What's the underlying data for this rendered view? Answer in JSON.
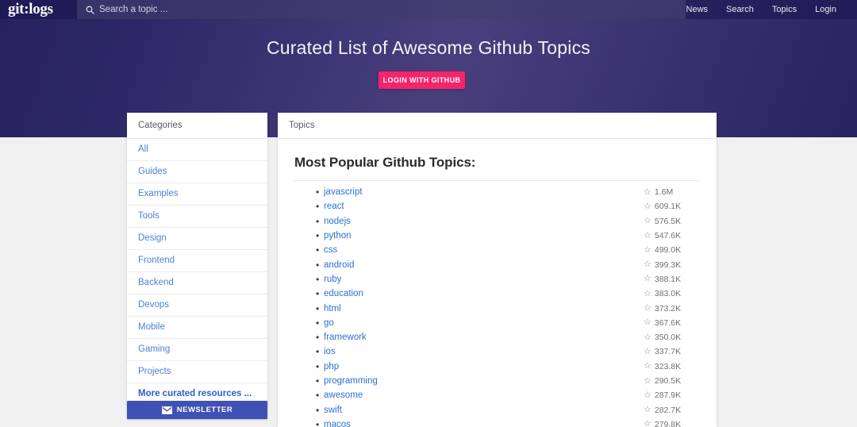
{
  "navbar": {
    "brand": "git:logs",
    "search": {
      "placeholder": "Search a topic ...",
      "value": "",
      "icon": "search-icon"
    },
    "links": [
      {
        "label": "News"
      },
      {
        "label": "Search"
      },
      {
        "label": "Topics"
      },
      {
        "label": "Login"
      }
    ]
  },
  "hero": {
    "title": "Curated List of Awesome Github Topics",
    "github_button": "LOGIN WITH GITHUB",
    "button_color": "#f5246b"
  },
  "sidebar": {
    "header": "Categories",
    "items": [
      {
        "label": "All"
      },
      {
        "label": "Guides"
      },
      {
        "label": "Examples"
      },
      {
        "label": "Tools"
      },
      {
        "label": "Design"
      },
      {
        "label": "Frontend"
      },
      {
        "label": "Backend"
      },
      {
        "label": "Devops"
      },
      {
        "label": "Mobile"
      },
      {
        "label": "Gaming"
      },
      {
        "label": "Projects"
      },
      {
        "label": "More curated resources ..."
      }
    ],
    "newsletter_button": {
      "label": "NEWSLETTER",
      "icon": "envelope-icon",
      "color": "#3f51b5"
    }
  },
  "main": {
    "header": "Topics",
    "heading": "Most Popular Github Topics:",
    "star_icon": "star-outline-icon",
    "topics": [
      {
        "name": "javascript",
        "stars": "1.6M"
      },
      {
        "name": "react",
        "stars": "609.1K"
      },
      {
        "name": "nodejs",
        "stars": "576.5K"
      },
      {
        "name": "python",
        "stars": "547.6K"
      },
      {
        "name": "css",
        "stars": "499.0K"
      },
      {
        "name": "android",
        "stars": "399.3K"
      },
      {
        "name": "ruby",
        "stars": "388.1K"
      },
      {
        "name": "education",
        "stars": "383.0K"
      },
      {
        "name": "html",
        "stars": "373.2K"
      },
      {
        "name": "go",
        "stars": "367.6K"
      },
      {
        "name": "framework",
        "stars": "350.0K"
      },
      {
        "name": "ios",
        "stars": "337.7K"
      },
      {
        "name": "php",
        "stars": "323.8K"
      },
      {
        "name": "programming",
        "stars": "290.5K"
      },
      {
        "name": "awesome",
        "stars": "287.9K"
      },
      {
        "name": "swift",
        "stars": "282.7K"
      },
      {
        "name": "macos",
        "stars": "279.8K"
      }
    ]
  }
}
